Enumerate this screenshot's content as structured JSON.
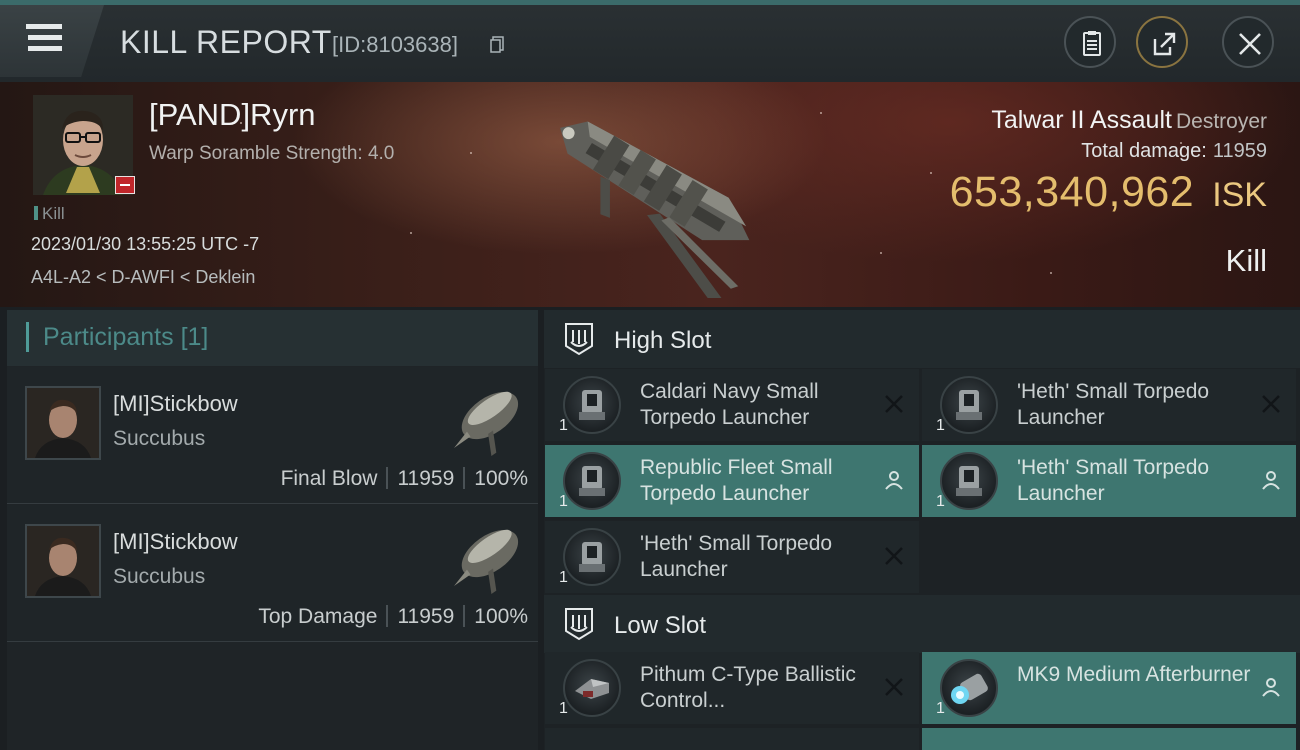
{
  "header": {
    "title": "KILL REPORT",
    "report_id": "[ID:8103638]"
  },
  "victim": {
    "name": "[PAND]Ryrn",
    "subtitle": "Warp Soramble Strength: 4.0",
    "tag": "Kill",
    "datetime": "2023/01/30 13:55:25 UTC -7",
    "location": "A4L-A2 < D-AWFI < Deklein",
    "ship_name": "Talwar II Assault",
    "ship_class": "Destroyer",
    "damage_label": "Total damage:",
    "damage_value": "11959",
    "isk_value": "653,340,962",
    "isk_unit": "ISK",
    "result": "Kill"
  },
  "participants": {
    "title": "Participants",
    "count": "[1]",
    "items": [
      {
        "name": "[MI]Stickbow",
        "ship": "Succubus",
        "role": "Final Blow",
        "damage": "11959",
        "percent": "100%"
      },
      {
        "name": "[MI]Stickbow",
        "ship": "Succubus",
        "role": "Top Damage",
        "damage": "11959",
        "percent": "100%"
      }
    ]
  },
  "fitting": {
    "high_slot": {
      "title": "High Slot",
      "modules": [
        {
          "name": "Caldari Navy Small Torpedo Launcher",
          "qty": "1",
          "status": "destroyed"
        },
        {
          "name": "'Heth' Small Torpedo Launcher",
          "qty": "1",
          "status": "destroyed"
        },
        {
          "name": "Republic Fleet Small Torpedo Launcher",
          "qty": "1",
          "status": "dropped"
        },
        {
          "name": "'Heth' Small Torpedo Launcher",
          "qty": "1",
          "status": "dropped"
        },
        {
          "name": "'Heth' Small Torpedo Launcher",
          "qty": "1",
          "status": "destroyed"
        }
      ]
    },
    "low_slot": {
      "title": "Low Slot",
      "modules": [
        {
          "name": "Pithum C-Type Ballistic Control...",
          "qty": "1",
          "status": "destroyed"
        },
        {
          "name": "MK9 Medium Afterburner",
          "qty": "1",
          "status": "dropped"
        }
      ]
    }
  },
  "colors": {
    "accent": "#4f9b98",
    "isk": "#e4bd6d",
    "dropped_bg": "#3e7670",
    "victim_badge": "#c0262a"
  }
}
